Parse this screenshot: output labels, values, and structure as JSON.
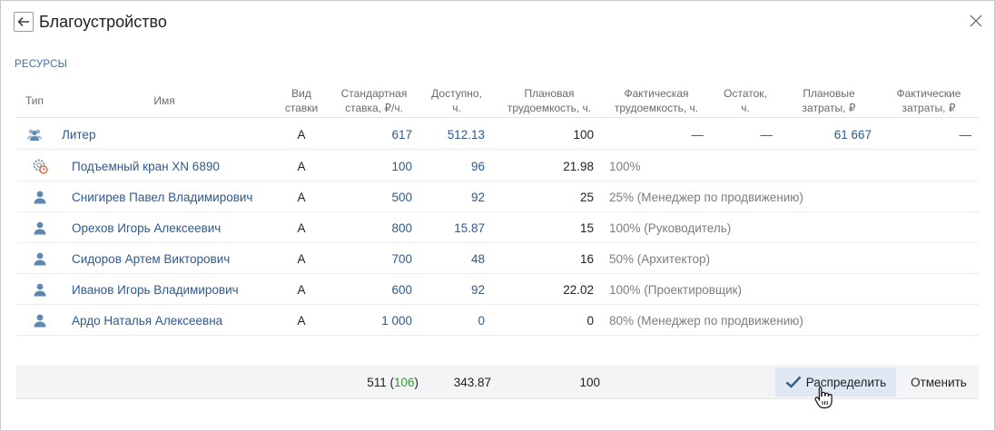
{
  "dialog": {
    "title": "Благоустройство",
    "section_label": "РЕСУРСЫ"
  },
  "columns": {
    "type": "Тип",
    "name": "Имя",
    "rate_type": [
      "Вид",
      "ставки"
    ],
    "standard_rate": [
      "Стандартная",
      "ставка, ₽/ч."
    ],
    "available": [
      "Доступно,",
      "ч."
    ],
    "planned_effort": [
      "Плановая",
      "трудоемкость, ч."
    ],
    "actual_effort": [
      "Фактическая",
      "трудоемкость, ч."
    ],
    "remainder": [
      "Остаток,",
      "ч."
    ],
    "planned_cost": [
      "Плановые",
      "затраты, ₽"
    ],
    "actual_cost": [
      "Фактические",
      "затраты, ₽"
    ]
  },
  "rows": [
    {
      "icon": "group-icon",
      "name": "Литер",
      "rate_type": "А",
      "standard_rate": "617",
      "available": "512.13",
      "planned_effort": "100",
      "actual_effort": "—",
      "remainder": "—",
      "planned_cost": "61 667",
      "actual_cost": "—"
    },
    {
      "icon": "equipment-icon",
      "name": "Подъемный кран XN 6890",
      "rate_type": "А",
      "standard_rate": "100",
      "available": "96",
      "planned_effort": "21.98",
      "actual_effort": "100%"
    },
    {
      "icon": "person-icon",
      "name": "Снигирев Павел Владимирович",
      "rate_type": "А",
      "standard_rate": "500",
      "available": "92",
      "planned_effort": "25",
      "actual_effort": "25% (Менеджер по продвижению)"
    },
    {
      "icon": "person-icon",
      "name": "Орехов Игорь Алексеевич",
      "rate_type": "А",
      "standard_rate": "800",
      "available": "15.87",
      "planned_effort": "15",
      "actual_effort": "100% (Руководитель)"
    },
    {
      "icon": "person-icon",
      "name": "Сидоров Артем Викторович",
      "rate_type": "А",
      "standard_rate": "700",
      "available": "48",
      "planned_effort": "16",
      "actual_effort": "50% (Архитектор)"
    },
    {
      "icon": "person-icon",
      "name": "Иванов Игорь Владимирович",
      "rate_type": "А",
      "standard_rate": "600",
      "available": "92",
      "planned_effort": "22.02",
      "actual_effort": "100% (Проектировщик)"
    },
    {
      "icon": "person-icon",
      "name": "Ардо Наталья Алексеевна",
      "rate_type": "А",
      "standard_rate": "1 000",
      "available": "0",
      "planned_effort": "0",
      "actual_effort": "80% (Менеджер по продвижению)"
    }
  ],
  "footer": {
    "rate_total": "511",
    "rate_total_extra": "106",
    "available_total": "343.87",
    "planned_total": "100",
    "distribute_label": "Распределить",
    "cancel_label": "Отменить"
  },
  "colors": {
    "link_blue": "#2e5a8e",
    "green": "#2a9a2a",
    "primary_button_bg": "#dfe8f3"
  }
}
